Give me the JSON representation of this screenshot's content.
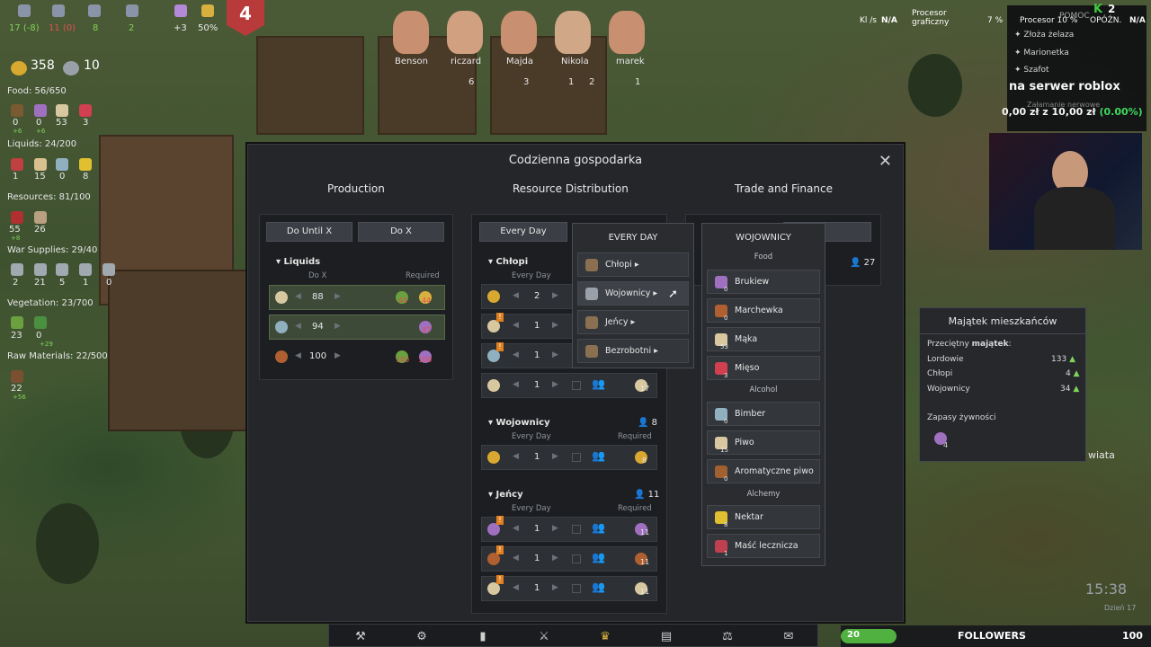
{
  "hud": {
    "pop_values": [
      "17 (-8)",
      "11 (0)",
      "8",
      "2",
      "+3",
      "50%"
    ],
    "day_badge": "4",
    "gold": "358",
    "timer": "10",
    "food": "Food: 56/650",
    "food_vals": [
      "0",
      "0",
      "53",
      "3"
    ],
    "food_deltas": [
      "+6",
      "+6"
    ],
    "liquids": "Liquids: 24/200",
    "liquid_vals": [
      "1",
      "15",
      "0",
      "8"
    ],
    "resources": "Resources: 81/100",
    "resource_vals": [
      "55",
      "26"
    ],
    "resource_delta": "+8",
    "war": "War Supplies: 29/40",
    "war_vals": [
      "2",
      "21",
      "5",
      "1",
      "0"
    ],
    "vegetation": "Vegetation: 23/700",
    "veg_vals": [
      "23",
      "0"
    ],
    "veg_delta": "+29",
    "raw": "Raw Materials: 22/500",
    "raw_vals": [
      "22"
    ],
    "raw_delta": "+56"
  },
  "characters": [
    {
      "name": "Benson"
    },
    {
      "name": "riczard",
      "val": "6"
    },
    {
      "name": "Majda",
      "val": "3"
    },
    {
      "name": "Nikola",
      "val": "1",
      "val2": "2"
    },
    {
      "name": "marek",
      "val": "1"
    }
  ],
  "panel": {
    "title": "Codzienna gospodarka",
    "tabs": [
      "Production",
      "Resource Distribution",
      "Trade and Finance"
    ],
    "production": {
      "buttons": [
        "Do Until X",
        "Do X"
      ],
      "section": "Liquids",
      "col1": "Do X",
      "col2": "Required",
      "rows": [
        {
          "v": "88",
          "r1": "44",
          "r2": "44"
        },
        {
          "v": "94",
          "r1": "47"
        },
        {
          "v": "100",
          "r1": "100",
          "r2": "100"
        }
      ]
    },
    "distribution": {
      "button": "Every Day",
      "groups": [
        {
          "name": "Chłopi",
          "sub": "Every Day",
          "rows": [
            {
              "v": "2"
            },
            {
              "v": "1"
            },
            {
              "v": "1"
            },
            {
              "v": "1",
              "req": "17"
            }
          ]
        },
        {
          "name": "Wojownicy",
          "count": "8",
          "sub": "Every Day",
          "req": "Required",
          "rows": [
            {
              "v": "1",
              "req": "8"
            }
          ]
        },
        {
          "name": "Jeńcy",
          "count": "11",
          "sub": "Every Day",
          "req": "Required",
          "rows": [
            {
              "v": "1",
              "req": "11"
            },
            {
              "v": "1",
              "req": "11"
            },
            {
              "v": "1",
              "req": "11"
            }
          ]
        }
      ]
    },
    "trade_value": "27"
  },
  "every_day_menu": {
    "title": "EVERY DAY",
    "items": [
      "Chłopi",
      "Wojownicy",
      "Jeńcy",
      "Bezrobotni"
    ]
  },
  "wojownicy_menu": {
    "title": "WOJOWNICY",
    "cat_food": "Food",
    "food": [
      {
        "n": "Brukiew",
        "q": "0"
      },
      {
        "n": "Marchewka",
        "q": "0"
      },
      {
        "n": "Mąka",
        "q": "53"
      },
      {
        "n": "Mięso",
        "q": "3"
      }
    ],
    "cat_alcohol": "Alcohol",
    "alcohol": [
      {
        "n": "Bimber",
        "q": "0"
      },
      {
        "n": "Piwo",
        "q": "15"
      },
      {
        "n": "Aromatyczne piwo",
        "q": "0"
      }
    ],
    "cat_alchemy": "Alchemy",
    "alchemy": [
      {
        "n": "Nektar",
        "q": "8"
      },
      {
        "n": "Maść lecznicza",
        "q": "1"
      }
    ]
  },
  "wealth": {
    "title": "Majątek mieszkańców",
    "avg": "Przeciętny ",
    "avg_bold": "majątek",
    "rows": [
      {
        "n": "Lordowie",
        "v": "133"
      },
      {
        "n": "Chłopi",
        "v": "4"
      },
      {
        "n": "Wojownicy",
        "v": "34"
      }
    ],
    "food_label": "Zapasy żywności",
    "food_val": "4"
  },
  "overlay": {
    "top_labels": [
      "Kl /s",
      "N/A",
      "Procesor",
      "graficzny",
      "7 %"
    ],
    "items": [
      "Złoża żelaza",
      "Marionetka",
      "Szafot"
    ],
    "banner": "na serwer roblox",
    "money": "0,00 zł z 10,00 zł",
    "money_pct": "(0.00%)",
    "help": "POMOC",
    "procesor": "Procesor 10 %",
    "opozn": "OPÓŹN.",
    "opozn_val": "N/A",
    "k_count": "2",
    "ghost": "Załamanie nerwowe"
  },
  "bottom": {
    "followers": "FOLLOWERS",
    "left_num": "20",
    "right_num": "100",
    "time": "15:38",
    "day": "Dzień 17",
    "wiata": "wiata"
  }
}
